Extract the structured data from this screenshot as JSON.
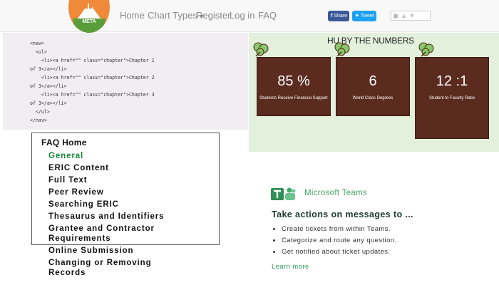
{
  "navbar": {
    "logo_text": "META",
    "links": [
      "Home",
      "Chart Types",
      "Register",
      "Log in",
      "FAQ"
    ],
    "share_label": "Share",
    "tweet_label": "Tweet",
    "vote_up_icon": "arrow-up-icon",
    "vote_down_icon": "arrow-down-icon"
  },
  "code_panel": {
    "code_lines": [
      "<nav>",
      "  <ul>",
      "    <li><a href=\"\" class=\"chapter\">Chapter 1",
      "of 3</a></li>",
      "    <li><a href=\"\" class=\"chapter\">Chapter 2",
      "of 3</a></li>",
      "    <li><a href=\"\" class=\"chapter\">Chapter 3",
      "of 3</a></li>",
      "  </ul>",
      "</nav>"
    ]
  },
  "stats": {
    "title": "HU BY THE NUMBERS",
    "accent_color": "#5a2b1e",
    "background_color": "#e3f0dc",
    "cards": [
      {
        "value": "85 %",
        "label": "Students Receive Financial Support"
      },
      {
        "value": "6",
        "label": "World Class Degrees"
      },
      {
        "value": "12 :1",
        "label": "Student to Faculty Ratio"
      }
    ]
  },
  "faq": {
    "home": "FAQ Home",
    "active_color": "#128a3c",
    "items": [
      "General",
      "ERIC Content",
      "Full Text",
      "Peer Review",
      "Searching ERIC",
      "Thesaurus and Identifiers",
      "Grantee and Contractor",
      "Requirements",
      "Online Submission",
      "Changing or Removing",
      "Records"
    ]
  },
  "teams": {
    "brand": "Microsoft Teams",
    "brand_color": "#47a36a",
    "heading": "Take actions on messages to ...",
    "bullets": [
      "Create tickets from within Teams.",
      "Categorize and route any question.",
      "Get notified about ticket updates."
    ],
    "learn_more": "Learn more"
  }
}
